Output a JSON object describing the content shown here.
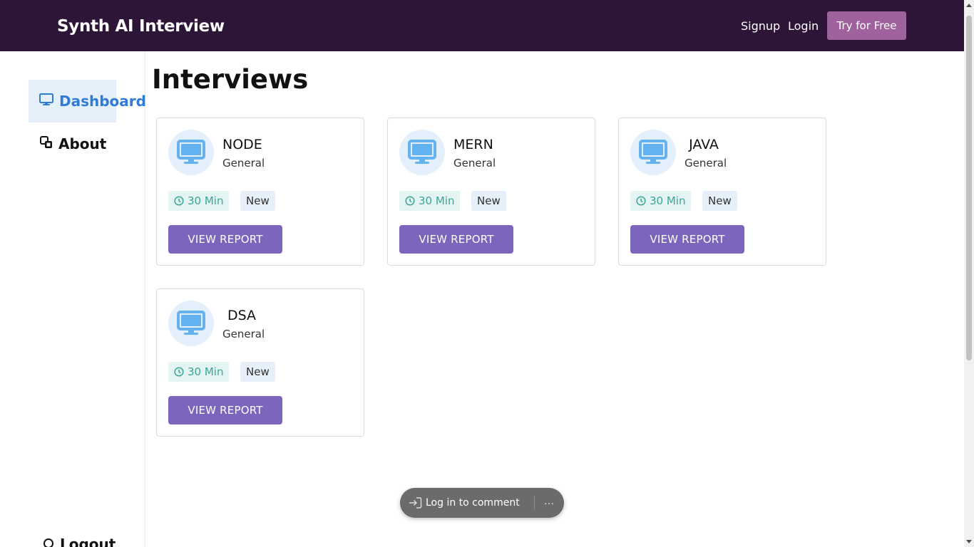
{
  "navbar": {
    "brand": "Synth AI Interview",
    "signup_label": "Signup",
    "login_label": "Login",
    "try_label": "Try for Free"
  },
  "sidebar": {
    "items": [
      {
        "label": "Dashboard",
        "icon": "monitor-icon",
        "active": true
      },
      {
        "label": "About",
        "icon": "copy-icon",
        "active": false
      },
      {
        "label": "Logout",
        "icon": "logout-icon",
        "active": false
      }
    ]
  },
  "main": {
    "title": "Interviews",
    "cards": [
      {
        "name": "NODE",
        "category": "General",
        "duration": "30 Min",
        "status": "New",
        "button": "VIEW REPORT"
      },
      {
        "name": "MERN",
        "category": "General",
        "duration": "30 Min",
        "status": "New",
        "button": "VIEW REPORT"
      },
      {
        "name": "JAVA",
        "category": "General",
        "duration": "30 Min",
        "status": "New",
        "button": "VIEW REPORT"
      },
      {
        "name": "DSA",
        "category": "General",
        "duration": "30 Min",
        "status": "New",
        "button": "VIEW REPORT"
      }
    ]
  },
  "comment_bar": {
    "login_label": "Log in to comment",
    "more_label": "···"
  },
  "colors": {
    "navbar_bg": "#2d1538",
    "accent_purple": "#7b65bd",
    "try_button": "#a0629c",
    "active_blue": "#2f7bd8",
    "chip_teal": "#3aa597"
  }
}
